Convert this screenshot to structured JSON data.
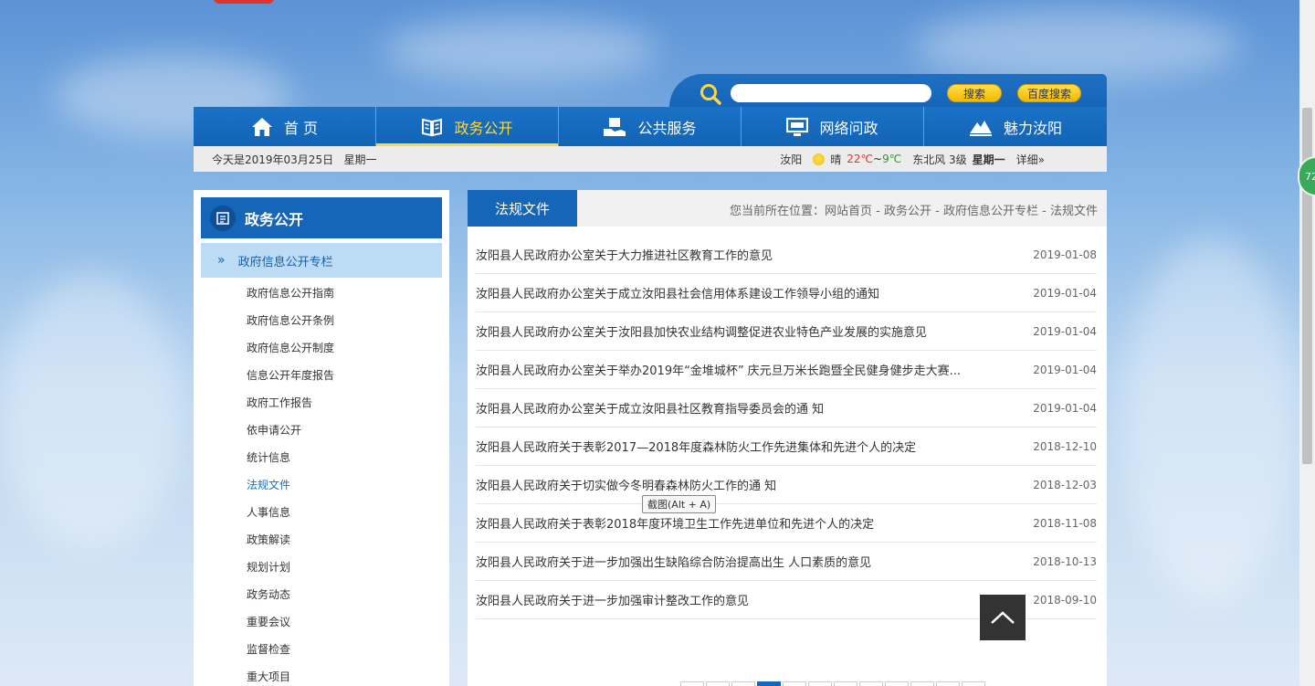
{
  "search": {
    "placeholder": "",
    "search_button": "搜索",
    "baidu_button": "百度搜索"
  },
  "nav": {
    "items": [
      {
        "label": "首 页",
        "icon": "home-icon"
      },
      {
        "label": "政务公开",
        "icon": "book-icon",
        "active": true
      },
      {
        "label": "公共服务",
        "icon": "service-icon"
      },
      {
        "label": "网络问政",
        "icon": "monitor-icon"
      },
      {
        "label": "魅力汝阳",
        "icon": "mountain-icon"
      }
    ]
  },
  "infobar": {
    "date": "今天是2019年03月25日   星期一",
    "city": "汝阳",
    "condition": "晴",
    "temp_high": "22℃",
    "temp_sep": "~",
    "temp_low": "9℃",
    "wind": "东北风 3级",
    "weekday": "星期一",
    "detail": "详细»"
  },
  "sidebar": {
    "title": "政务公开",
    "sub_title": "政府信息公开专栏",
    "items": [
      "政府信息公开指南",
      "政府信息公开条例",
      "政府信息公开制度",
      "信息公开年度报告",
      "政府工作报告",
      "依申请公开",
      "统计信息",
      "法规文件",
      "人事信息",
      "政策解读",
      "规划计划",
      "政务动态",
      "重要会议",
      "监督检查",
      "重大项目"
    ],
    "active_item": "法规文件"
  },
  "main": {
    "tab": "法规文件",
    "breadcrumb": {
      "prefix": "您当前所在位置：",
      "home": "网站首页",
      "sep": " - ",
      "level1": "政务公开",
      "level2": "政府信息公开专栏",
      "level3": "法规文件"
    },
    "articles": [
      {
        "title": "汝阳县人民政府办公室关于大力推进社区教育工作的意见",
        "date": "2019-01-08"
      },
      {
        "title": "汝阳县人民政府办公室关于成立汝阳县社会信用体系建设工作领导小组的通知",
        "date": "2019-01-04"
      },
      {
        "title": "汝阳县人民政府办公室关于汝阳县加快农业结构调整促进农业特色产业发展的实施意见",
        "date": "2019-01-04"
      },
      {
        "title": "汝阳县人民政府办公室关于举办2019年“金堆城杯” 庆元旦万米长跑暨全民健身健步走大赛...",
        "date": "2019-01-04"
      },
      {
        "title": "汝阳县人民政府办公室关于成立汝阳县社区教育指导委员会的通 知",
        "date": "2019-01-04"
      },
      {
        "title": "汝阳县人民政府关于表彰2017—2018年度森林防火工作先进集体和先进个人的决定",
        "date": "2018-12-10"
      },
      {
        "title": "汝阳县人民政府关于切实做今冬明春森林防火工作的通 知",
        "date": "2018-12-03"
      },
      {
        "title": "汝阳县人民政府关于表彰2018年度环境卫生工作先进单位和先进个人的决定",
        "date": "2018-11-08"
      },
      {
        "title": "汝阳县人民政府关于进一步加强出生缺陷综合防治提高出生 人口素质的意见",
        "date": "2018-10-13"
      },
      {
        "title": "汝阳县人民政府关于进一步加强审计整改工作的意见",
        "date": "2018-09-10"
      }
    ]
  },
  "tooltip": "截图(Alt + A)",
  "float_badge": "72",
  "colors": {
    "nav_blue": "#1565b8",
    "active_yellow": "#ffd93a",
    "temp_high": "#e4332a",
    "temp_low": "#2c9b2c"
  }
}
